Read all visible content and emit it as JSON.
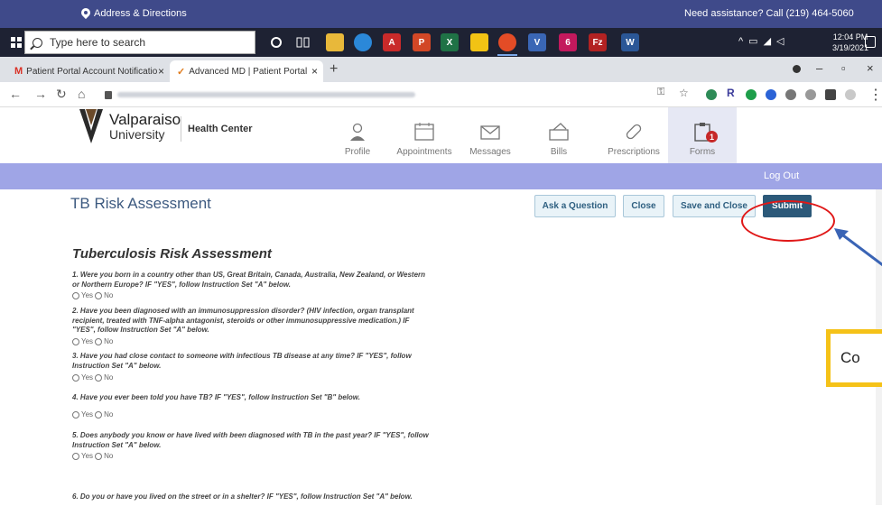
{
  "site_bar": {
    "address_label": "Address & Directions",
    "assistance": "Need assistance? Call (219) 464-5060"
  },
  "taskbar": {
    "search_placeholder": "Type here to search",
    "time": "12:04 PM",
    "date": "3/19/2021",
    "apps": [
      "cortana",
      "task-view",
      "file-explorer",
      "edge",
      "acrobat",
      "powerpoint",
      "excel",
      "sticky-notes",
      "chrome",
      "visio",
      "onenote-badge",
      "filezilla",
      "word"
    ],
    "onenote_badge": "6"
  },
  "browser": {
    "tabs": [
      {
        "label": "Patient Portal Account Notificatio",
        "icon": "gmail-icon"
      },
      {
        "label": "Advanced MD | Patient Portal",
        "icon": "advancedmd-icon"
      }
    ],
    "new_tab": "+"
  },
  "portal": {
    "brand_name": "Valparaiso",
    "brand_sub": "University",
    "center": "Health Center",
    "nav": [
      {
        "label": "Profile",
        "icon": "profile-icon"
      },
      {
        "label": "Appointments",
        "icon": "calendar-icon"
      },
      {
        "label": "Messages",
        "icon": "envelope-icon"
      },
      {
        "label": "Bills",
        "icon": "bills-icon"
      },
      {
        "label": "Prescriptions",
        "icon": "pill-icon"
      },
      {
        "label": "Forms",
        "icon": "clipboard-icon",
        "badge": "1"
      }
    ],
    "logout": "Log Out"
  },
  "page": {
    "title": "TB Risk Assessment",
    "buttons": {
      "ask": "Ask a Question",
      "close": "Close",
      "save_close": "Save and Close",
      "submit": "Submit"
    },
    "form_title": "Tuberculosis Risk Assessment",
    "yes": "Yes",
    "no": "No",
    "questions": [
      "1. Were you born in a country other than US, Great Britain, Canada, Australia, New Zealand, or Western or Northern Europe? IF \"YES\", follow Instruction Set \"A\" below.",
      "2. Have you been diagnosed with an immunosuppression disorder? (HIV infection, organ transplant recipient, treated with TNF-alpha antagonist, steroids or other immunosuppressive medication.) IF \"YES\", follow Instruction Set \"A\" below.",
      "3. Have you had close contact to someone with infectious TB disease at any time? IF \"YES\", follow Instruction Set \"A\" below.",
      "4. Have you ever been told you have TB? IF \"YES\", follow Instruction Set \"B\" below.",
      "5. Does anybody you know or have lived with been diagnosed with TB in the past year? IF \"YES\", follow Instruction Set \"A\" below.",
      "6. Do you or have you lived on the street or in a shelter? IF \"YES\", follow Instruction Set \"A\" below."
    ]
  },
  "annotation": {
    "callout_text": "Co"
  }
}
